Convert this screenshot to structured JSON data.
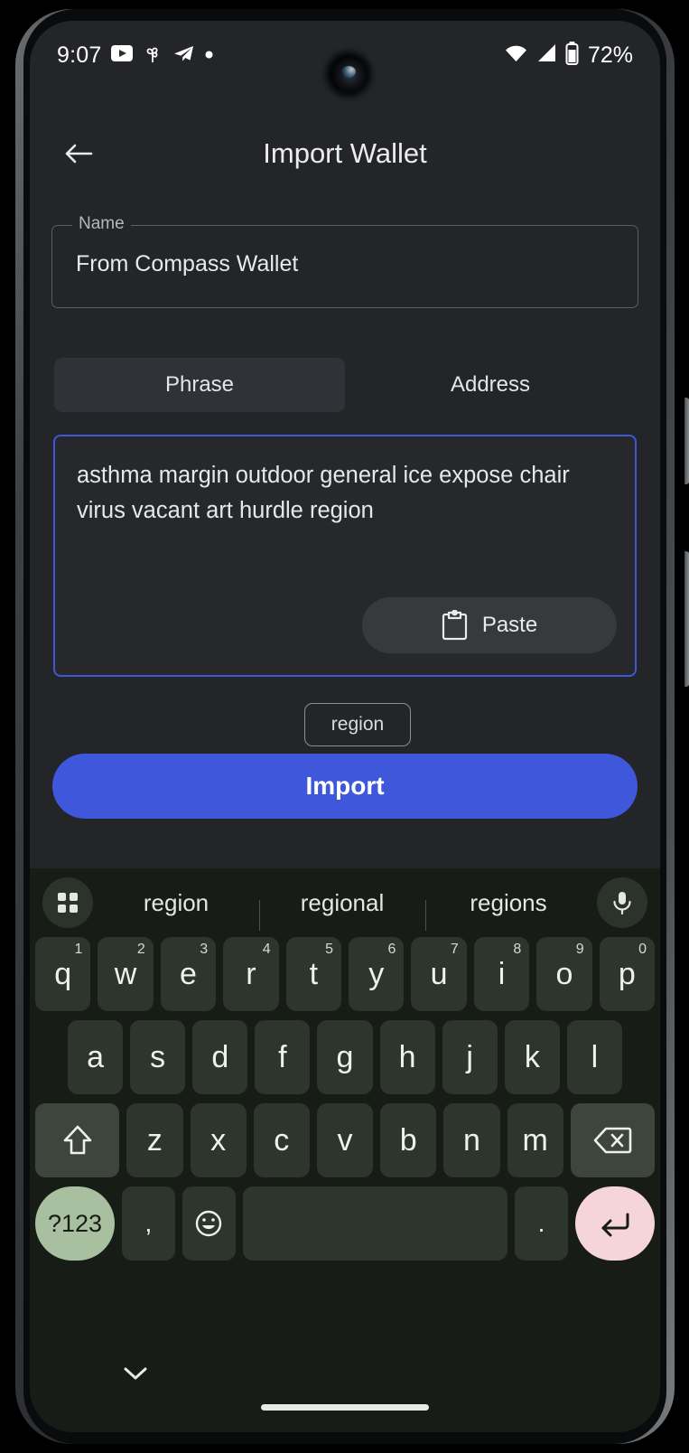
{
  "status_bar": {
    "time": "9:07",
    "battery_percent": "72%",
    "icons": [
      "youtube-icon",
      "pinwheel-icon",
      "telegram-icon",
      "dot-icon",
      "wifi-icon",
      "cellular-signal-icon",
      "battery-icon"
    ]
  },
  "app_bar": {
    "back_icon": "arrow-left-icon",
    "title": "Import Wallet"
  },
  "name_field": {
    "label": "Name",
    "value": "From Compass Wallet"
  },
  "tabs": [
    {
      "label": "Phrase",
      "selected": true
    },
    {
      "label": "Address",
      "selected": false
    }
  ],
  "phrase_input": {
    "value": "asthma margin outdoor general ice expose chair virus vacant art hurdle region",
    "paste_label": "Paste",
    "paste_icon": "clipboard-icon",
    "focus_color": "#3f57db"
  },
  "word_chip": {
    "label": "region"
  },
  "import_button": {
    "label": "Import",
    "color": "#3f57db"
  },
  "keyboard": {
    "suggestions": [
      "region",
      "regional",
      "regions"
    ],
    "grid_icon": "grid-squares-icon",
    "mic_icon": "microphone-icon",
    "row1": [
      {
        "letter": "q",
        "num": "1"
      },
      {
        "letter": "w",
        "num": "2"
      },
      {
        "letter": "e",
        "num": "3"
      },
      {
        "letter": "r",
        "num": "4"
      },
      {
        "letter": "t",
        "num": "5"
      },
      {
        "letter": "y",
        "num": "6"
      },
      {
        "letter": "u",
        "num": "7"
      },
      {
        "letter": "i",
        "num": "8"
      },
      {
        "letter": "o",
        "num": "9"
      },
      {
        "letter": "p",
        "num": "0"
      }
    ],
    "row2": [
      "a",
      "s",
      "d",
      "f",
      "g",
      "h",
      "j",
      "k",
      "l"
    ],
    "row3": {
      "shift_icon": "shift-up-arrow-icon",
      "letters": [
        "z",
        "x",
        "c",
        "v",
        "b",
        "n",
        "m"
      ],
      "backspace_icon": "backspace-icon"
    },
    "row4": {
      "symbols_label": "?123",
      "comma": ",",
      "emoji_icon": "emoji-smiley-icon",
      "space": "",
      "period": ".",
      "enter_icon": "enter-return-icon"
    },
    "hide_icon": "chevron-down-icon",
    "symbols_key_color": "#a8c0a0",
    "enter_key_color": "#f5d5da"
  }
}
